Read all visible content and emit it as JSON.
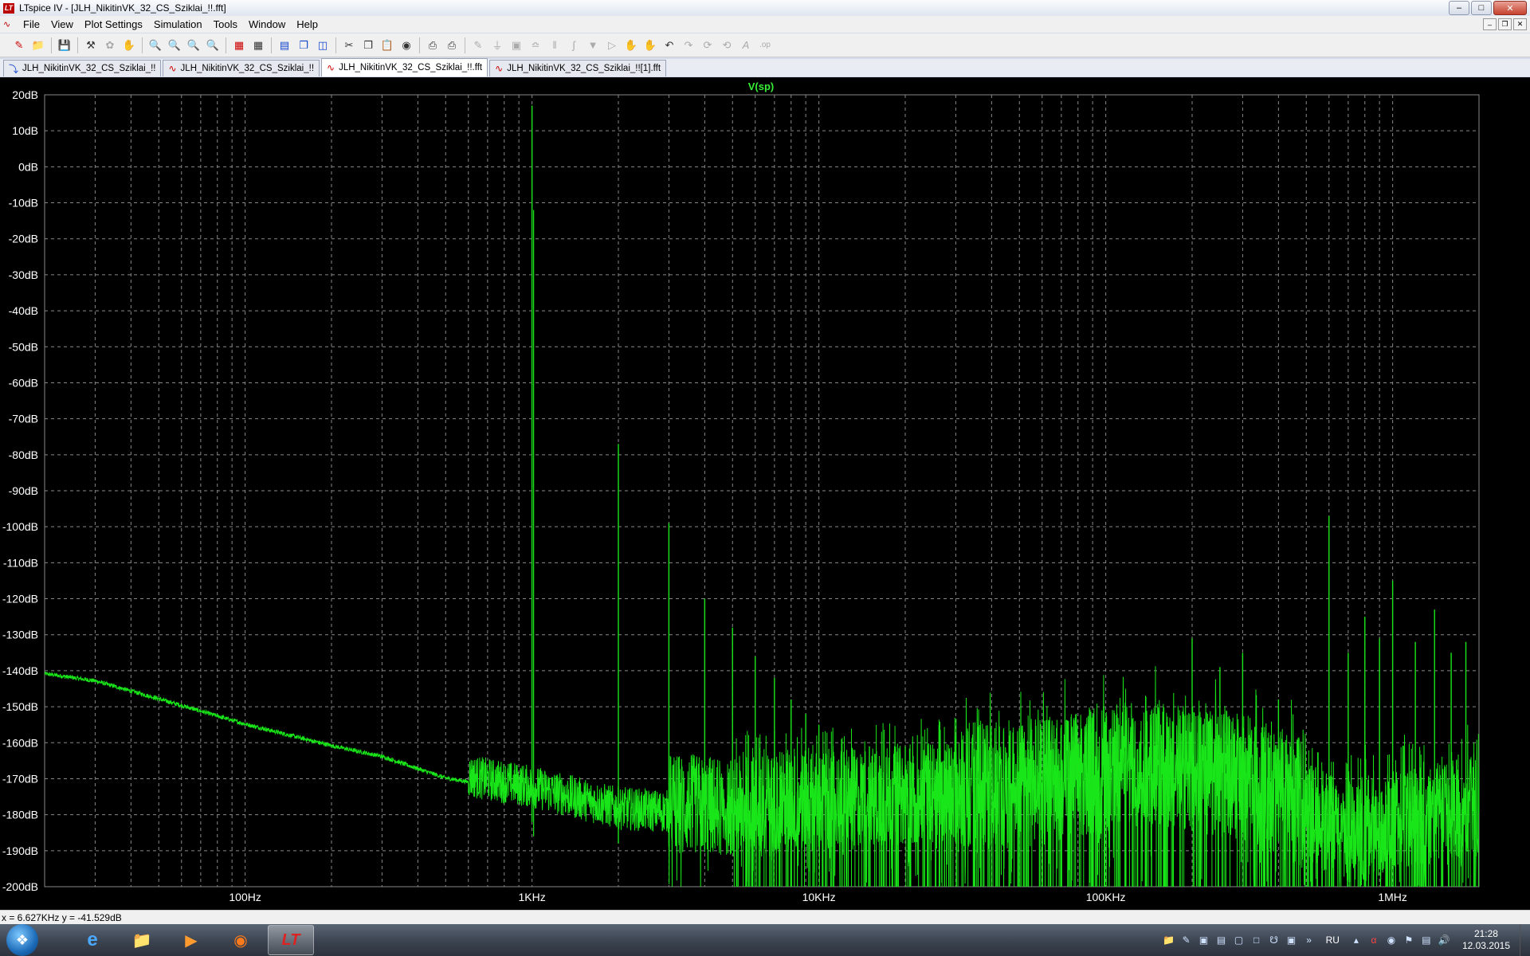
{
  "window": {
    "app_icon": "LT",
    "title": "LTspice IV - [JLH_NikitinVK_32_CS_Sziklai_!!.fft]",
    "controls": [
      "minimize-icon",
      "maximize-icon",
      "close-icon"
    ]
  },
  "menu": [
    "File",
    "View",
    "Plot Settings",
    "Simulation",
    "Tools",
    "Window",
    "Help"
  ],
  "tabs": [
    {
      "label": "JLH_NikitinVK_32_CS_Sziklai_!!",
      "icon": "schematic-icon",
      "active": false
    },
    {
      "label": "JLH_NikitinVK_32_CS_Sziklai_!!",
      "icon": "waveform-icon",
      "active": false
    },
    {
      "label": "JLH_NikitinVK_32_CS_Sziklai_!!.fft",
      "icon": "waveform-icon",
      "active": true
    },
    {
      "label": "JLH_NikitinVK_32_CS_Sziklai_!![1].fft",
      "icon": "waveform-icon",
      "active": false
    }
  ],
  "status": {
    "readout": "x = 6.627KHz    y = -41.529dB"
  },
  "taskbar": {
    "apps": [
      "internet-explorer-icon",
      "file-explorer-icon",
      "media-player-icon",
      "firefox-icon",
      "ltspice-icon"
    ],
    "lang": "RU",
    "time": "21:28",
    "date": "12.03.2015"
  },
  "chart_data": {
    "type": "line",
    "title": "V(sp)",
    "xlabel": "",
    "ylabel": "",
    "x_scale": "log",
    "xlim": [
      20,
      2000000
    ],
    "ylim": [
      -200,
      20
    ],
    "x_ticks": [
      {
        "v": 100,
        "label": "100Hz"
      },
      {
        "v": 1000,
        "label": "1KHz"
      },
      {
        "v": 10000,
        "label": "10KHz"
      },
      {
        "v": 100000,
        "label": "100KHz"
      },
      {
        "v": 1000000,
        "label": "1MHz"
      }
    ],
    "y_ticks": [
      20,
      10,
      0,
      -10,
      -20,
      -30,
      -40,
      -50,
      -60,
      -70,
      -80,
      -90,
      -100,
      -110,
      -120,
      -130,
      -140,
      -150,
      -160,
      -170,
      -180,
      -190,
      -200
    ],
    "y_tick_labels": [
      "20dB",
      "10dB",
      "0dB",
      "-10dB",
      "-20dB",
      "-30dB",
      "-40dB",
      "-50dB",
      "-60dB",
      "-70dB",
      "-80dB",
      "-90dB",
      "-100dB",
      "-110dB",
      "-120dB",
      "-130dB",
      "-140dB",
      "-150dB",
      "-160dB",
      "-170dB",
      "-180dB",
      "-190dB",
      "-200dB"
    ],
    "grid": true,
    "colors": {
      "trace": "#19e619",
      "background": "#000000",
      "grid": "#888888",
      "axis_text": "#ffffff",
      "title": "#36ef36"
    },
    "noise_floor": [
      [
        20,
        -141
      ],
      [
        30,
        -143
      ],
      [
        50,
        -148
      ],
      [
        100,
        -155
      ],
      [
        200,
        -161
      ],
      [
        300,
        -164
      ],
      [
        500,
        -170
      ],
      [
        1000,
        -174
      ],
      [
        2000,
        -180
      ],
      [
        5000,
        -182
      ],
      [
        10000,
        -180
      ],
      [
        30000,
        -178
      ],
      [
        60000,
        -176
      ],
      [
        100000,
        -173
      ],
      [
        150000,
        -171
      ],
      [
        300000,
        -175
      ],
      [
        500000,
        -183
      ],
      [
        700000,
        -190
      ],
      [
        1000000,
        -186
      ],
      [
        1800000,
        -182
      ]
    ],
    "harmonics": [
      {
        "f": 1000,
        "db": 17
      },
      {
        "f": 2000,
        "db": -77
      },
      {
        "f": 3000,
        "db": -99
      },
      {
        "f": 4000,
        "db": -120
      },
      {
        "f": 5000,
        "db": -128
      },
      {
        "f": 6000,
        "db": -136
      },
      {
        "f": 7000,
        "db": -142
      },
      {
        "f": 8000,
        "db": -148
      },
      {
        "f": 9000,
        "db": -152
      },
      {
        "f": 10000,
        "db": -155
      },
      {
        "f": 12000,
        "db": -159
      },
      {
        "f": 15000,
        "db": -161
      },
      {
        "f": 20000,
        "db": -161
      },
      {
        "f": 30000,
        "db": -158
      },
      {
        "f": 50000,
        "db": -156
      },
      {
        "f": 70000,
        "db": -155
      },
      {
        "f": 100000,
        "db": -153
      },
      {
        "f": 150000,
        "db": -152
      },
      {
        "f": 200000,
        "db": -131
      },
      {
        "f": 250000,
        "db": -139
      },
      {
        "f": 300000,
        "db": -135
      },
      {
        "f": 400000,
        "db": -148
      },
      {
        "f": 600000,
        "db": -97
      },
      {
        "f": 700000,
        "db": -135
      },
      {
        "f": 800000,
        "db": -125
      },
      {
        "f": 900000,
        "db": -131
      },
      {
        "f": 1000000,
        "db": -115
      },
      {
        "f": 1200000,
        "db": -132
      },
      {
        "f": 1400000,
        "db": -123
      },
      {
        "f": 1600000,
        "db": -135
      },
      {
        "f": 1800000,
        "db": -132
      }
    ]
  }
}
